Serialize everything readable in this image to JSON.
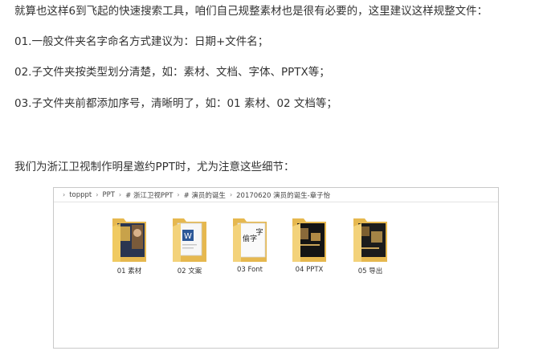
{
  "article": {
    "paragraphs": [
      "就算也这样6到飞起的快速搜索工具，咱们自己规整素材也是很有必要的，这里建议这样规整文件：",
      "01.一般文件夹名字命名方式建议为：日期+文件名；",
      "02.子文件夹按类型划分清楚，如：素材、文档、字体、PPTX等；",
      "03.子文件夹前都添加序号，清晰明了，如：01 素材、02 文档等；",
      "我们为浙江卫视制作明星邀约PPT时，尤为注意这些细节："
    ]
  },
  "explorer": {
    "breadcrumb": [
      "topppt",
      "PPT",
      "# 浙江卫视PPT",
      "# 演员的诞生",
      "20170620 演员的诞生-章子怡"
    ],
    "separator": "›",
    "folders": [
      {
        "label": "01 素材",
        "icon": "folder-images-icon"
      },
      {
        "label": "02 文案",
        "icon": "folder-document-icon"
      },
      {
        "label": "03 Font",
        "icon": "folder-font-icon",
        "glyph_a": "偷字",
        "glyph_b": "字"
      },
      {
        "label": "04 PPTX",
        "icon": "folder-slides-icon"
      },
      {
        "label": "05 导出",
        "icon": "folder-export-icon"
      }
    ],
    "colors": {
      "folder": "#f3d27a",
      "folder_dark": "#e6b84f",
      "doc_blue": "#2b5797"
    }
  }
}
